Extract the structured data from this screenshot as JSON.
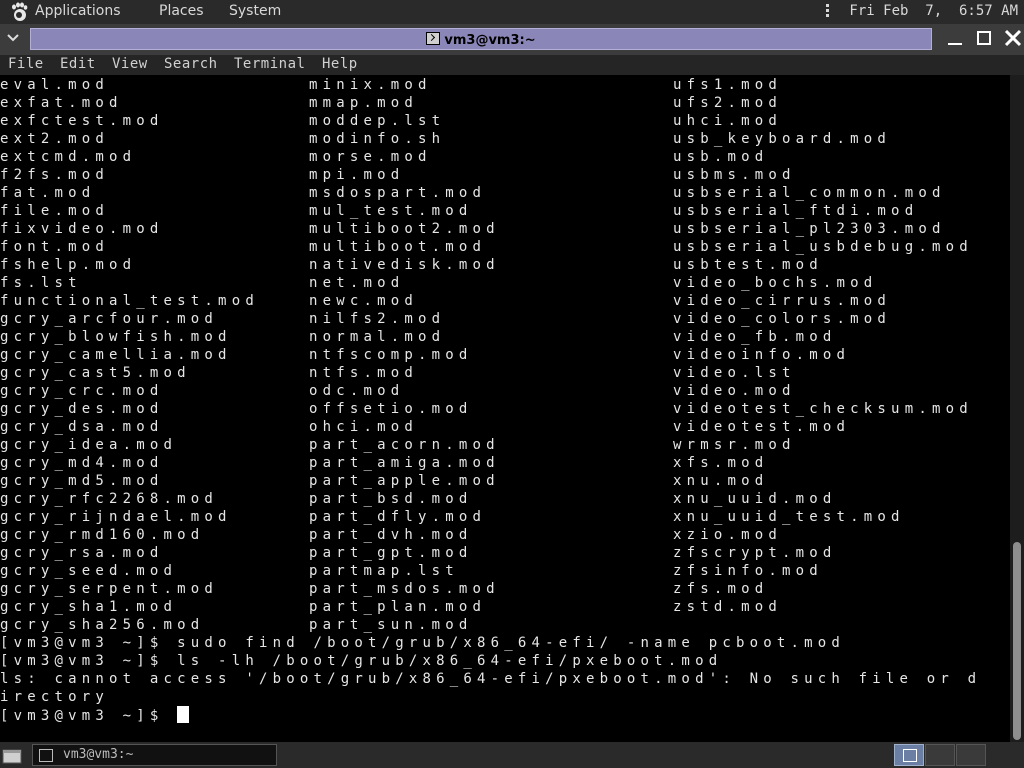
{
  "top_panel": {
    "menus": [
      "Applications",
      "Places",
      "System"
    ],
    "clock": "Fri Feb  7,  6:57 AM"
  },
  "window": {
    "title": "vm3@vm3:~"
  },
  "menubar": [
    "File",
    "Edit",
    "View",
    "Search",
    "Terminal",
    "Help"
  ],
  "terminal": {
    "col1": [
      "eval.mod",
      "exfat.mod",
      "exfctest.mod",
      "ext2.mod",
      "extcmd.mod",
      "f2fs.mod",
      "fat.mod",
      "file.mod",
      "fixvideo.mod",
      "font.mod",
      "fshelp.mod",
      "fs.lst",
      "functional_test.mod",
      "gcry_arcfour.mod",
      "gcry_blowfish.mod",
      "gcry_camellia.mod",
      "gcry_cast5.mod",
      "gcry_crc.mod",
      "gcry_des.mod",
      "gcry_dsa.mod",
      "gcry_idea.mod",
      "gcry_md4.mod",
      "gcry_md5.mod",
      "gcry_rfc2268.mod",
      "gcry_rijndael.mod",
      "gcry_rmd160.mod",
      "gcry_rsa.mod",
      "gcry_seed.mod",
      "gcry_serpent.mod",
      "gcry_sha1.mod",
      "gcry_sha256.mod"
    ],
    "col2": [
      "minix.mod",
      "mmap.mod",
      "moddep.lst",
      "modinfo.sh",
      "morse.mod",
      "mpi.mod",
      "msdospart.mod",
      "mul_test.mod",
      "multiboot2.mod",
      "multiboot.mod",
      "nativedisk.mod",
      "net.mod",
      "newc.mod",
      "nilfs2.mod",
      "normal.mod",
      "ntfscomp.mod",
      "ntfs.mod",
      "odc.mod",
      "offsetio.mod",
      "ohci.mod",
      "part_acorn.mod",
      "part_amiga.mod",
      "part_apple.mod",
      "part_bsd.mod",
      "part_dfly.mod",
      "part_dvh.mod",
      "part_gpt.mod",
      "partmap.lst",
      "part_msdos.mod",
      "part_plan.mod",
      "part_sun.mod"
    ],
    "col3": [
      "ufs1.mod",
      "ufs2.mod",
      "uhci.mod",
      "usb_keyboard.mod",
      "usb.mod",
      "usbms.mod",
      "usbserial_common.mod",
      "usbserial_ftdi.mod",
      "usbserial_pl2303.mod",
      "usbserial_usbdebug.mod",
      "usbtest.mod",
      "video_bochs.mod",
      "video_cirrus.mod",
      "video_colors.mod",
      "video_fb.mod",
      "videoinfo.mod",
      "video.lst",
      "video.mod",
      "videotest_checksum.mod",
      "videotest.mod",
      "wrmsr.mod",
      "xfs.mod",
      "xnu.mod",
      "xnu_uuid.mod",
      "xnu_uuid_test.mod",
      "xzio.mod",
      "zfscrypt.mod",
      "zfsinfo.mod",
      "zfs.mod",
      "zstd.mod"
    ],
    "cmd1": "[vm3@vm3 ~]$ sudo find /boot/grub/x86_64-efi/ -name pcboot.mod",
    "cmd2": "[vm3@vm3 ~]$ ls -lh /boot/grub/x86_64-efi/pxeboot.mod",
    "err1": "ls: cannot access '/boot/grub/x86_64-efi/pxeboot.mod': No such file or d",
    "err2": "irectory",
    "prompt": "[vm3@vm3 ~]$ "
  },
  "bottom_panel": {
    "task_label": "vm3@vm3:~"
  },
  "icons": {
    "top_left": "gnome-foot-icon",
    "window_menu": "chevron-down-icon",
    "terminal": "terminal-icon",
    "minimize": "minimize-icon",
    "maximize": "maximize-icon",
    "close": "close-icon",
    "show_desktop": "show-desktop-icon"
  },
  "colors": {
    "title_active": "#8b86b8",
    "panel": "#2a2a2a",
    "terminal_bg": "#000000",
    "terminal_fg": "#e6e6e6"
  }
}
